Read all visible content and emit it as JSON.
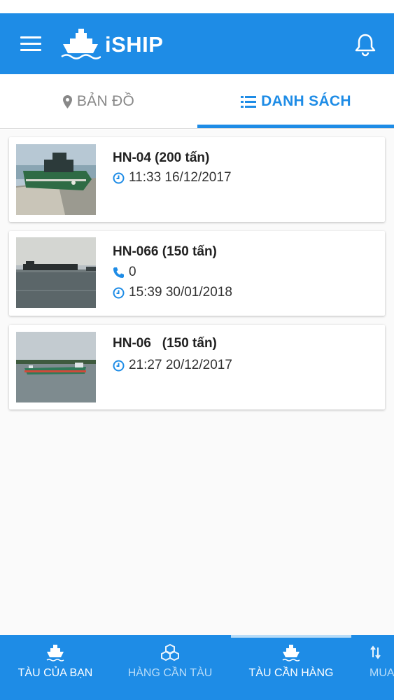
{
  "app": {
    "title": "iSHIP",
    "accent": "#1e8ce6"
  },
  "header": {
    "menu_icon": "menu-icon",
    "logo_icon": "ship-logo-icon",
    "bell_icon": "bell-icon"
  },
  "tabs": [
    {
      "label": "BẢN ĐỒ",
      "icon": "map-marker-icon",
      "active": false
    },
    {
      "label": "DANH SÁCH",
      "icon": "list-icon",
      "active": true
    }
  ],
  "ships": [
    {
      "title": "HN-04 (200 tấn)",
      "phone": null,
      "datetime": "11:33 16/12/2017"
    },
    {
      "title": "HN-066 (150 tấn)",
      "phone": "0",
      "datetime": "15:39 30/01/2018"
    },
    {
      "title": "HN-06   (150 tấn)",
      "phone": null,
      "datetime": "21:27 20/12/2017"
    }
  ],
  "bottom_nav": [
    {
      "label": "TÀU CỦA BẠN",
      "icon": "ship-icon",
      "active": false
    },
    {
      "label": "HÀNG CẦN TÀU",
      "icon": "cargo-icon",
      "active": false
    },
    {
      "label": "TÀU CẦN HÀNG",
      "icon": "ship-icon",
      "active": true
    },
    {
      "label": "MUA",
      "icon": "sort-icon",
      "active": false
    }
  ]
}
